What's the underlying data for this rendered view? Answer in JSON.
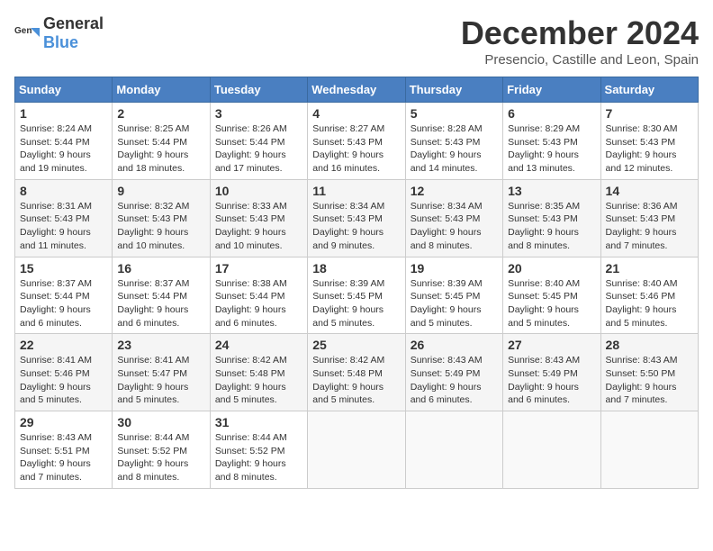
{
  "logo": {
    "general": "General",
    "blue": "Blue"
  },
  "title": {
    "month": "December 2024",
    "location": "Presencio, Castille and Leon, Spain"
  },
  "headers": [
    "Sunday",
    "Monday",
    "Tuesday",
    "Wednesday",
    "Thursday",
    "Friday",
    "Saturday"
  ],
  "weeks": [
    [
      {
        "day": "1",
        "sunrise": "8:24 AM",
        "sunset": "5:44 PM",
        "daylight": "9 hours and 19 minutes."
      },
      {
        "day": "2",
        "sunrise": "8:25 AM",
        "sunset": "5:44 PM",
        "daylight": "9 hours and 18 minutes."
      },
      {
        "day": "3",
        "sunrise": "8:26 AM",
        "sunset": "5:44 PM",
        "daylight": "9 hours and 17 minutes."
      },
      {
        "day": "4",
        "sunrise": "8:27 AM",
        "sunset": "5:43 PM",
        "daylight": "9 hours and 16 minutes."
      },
      {
        "day": "5",
        "sunrise": "8:28 AM",
        "sunset": "5:43 PM",
        "daylight": "9 hours and 14 minutes."
      },
      {
        "day": "6",
        "sunrise": "8:29 AM",
        "sunset": "5:43 PM",
        "daylight": "9 hours and 13 minutes."
      },
      {
        "day": "7",
        "sunrise": "8:30 AM",
        "sunset": "5:43 PM",
        "daylight": "9 hours and 12 minutes."
      }
    ],
    [
      {
        "day": "8",
        "sunrise": "8:31 AM",
        "sunset": "5:43 PM",
        "daylight": "9 hours and 11 minutes."
      },
      {
        "day": "9",
        "sunrise": "8:32 AM",
        "sunset": "5:43 PM",
        "daylight": "9 hours and 10 minutes."
      },
      {
        "day": "10",
        "sunrise": "8:33 AM",
        "sunset": "5:43 PM",
        "daylight": "9 hours and 10 minutes."
      },
      {
        "day": "11",
        "sunrise": "8:34 AM",
        "sunset": "5:43 PM",
        "daylight": "9 hours and 9 minutes."
      },
      {
        "day": "12",
        "sunrise": "8:34 AM",
        "sunset": "5:43 PM",
        "daylight": "9 hours and 8 minutes."
      },
      {
        "day": "13",
        "sunrise": "8:35 AM",
        "sunset": "5:43 PM",
        "daylight": "9 hours and 8 minutes."
      },
      {
        "day": "14",
        "sunrise": "8:36 AM",
        "sunset": "5:43 PM",
        "daylight": "9 hours and 7 minutes."
      }
    ],
    [
      {
        "day": "15",
        "sunrise": "8:37 AM",
        "sunset": "5:44 PM",
        "daylight": "9 hours and 6 minutes."
      },
      {
        "day": "16",
        "sunrise": "8:37 AM",
        "sunset": "5:44 PM",
        "daylight": "9 hours and 6 minutes."
      },
      {
        "day": "17",
        "sunrise": "8:38 AM",
        "sunset": "5:44 PM",
        "daylight": "9 hours and 6 minutes."
      },
      {
        "day": "18",
        "sunrise": "8:39 AM",
        "sunset": "5:45 PM",
        "daylight": "9 hours and 5 minutes."
      },
      {
        "day": "19",
        "sunrise": "8:39 AM",
        "sunset": "5:45 PM",
        "daylight": "9 hours and 5 minutes."
      },
      {
        "day": "20",
        "sunrise": "8:40 AM",
        "sunset": "5:45 PM",
        "daylight": "9 hours and 5 minutes."
      },
      {
        "day": "21",
        "sunrise": "8:40 AM",
        "sunset": "5:46 PM",
        "daylight": "9 hours and 5 minutes."
      }
    ],
    [
      {
        "day": "22",
        "sunrise": "8:41 AM",
        "sunset": "5:46 PM",
        "daylight": "9 hours and 5 minutes."
      },
      {
        "day": "23",
        "sunrise": "8:41 AM",
        "sunset": "5:47 PM",
        "daylight": "9 hours and 5 minutes."
      },
      {
        "day": "24",
        "sunrise": "8:42 AM",
        "sunset": "5:48 PM",
        "daylight": "9 hours and 5 minutes."
      },
      {
        "day": "25",
        "sunrise": "8:42 AM",
        "sunset": "5:48 PM",
        "daylight": "9 hours and 5 minutes."
      },
      {
        "day": "26",
        "sunrise": "8:43 AM",
        "sunset": "5:49 PM",
        "daylight": "9 hours and 6 minutes."
      },
      {
        "day": "27",
        "sunrise": "8:43 AM",
        "sunset": "5:49 PM",
        "daylight": "9 hours and 6 minutes."
      },
      {
        "day": "28",
        "sunrise": "8:43 AM",
        "sunset": "5:50 PM",
        "daylight": "9 hours and 7 minutes."
      }
    ],
    [
      {
        "day": "29",
        "sunrise": "8:43 AM",
        "sunset": "5:51 PM",
        "daylight": "9 hours and 7 minutes."
      },
      {
        "day": "30",
        "sunrise": "8:44 AM",
        "sunset": "5:52 PM",
        "daylight": "9 hours and 8 minutes."
      },
      {
        "day": "31",
        "sunrise": "8:44 AM",
        "sunset": "5:52 PM",
        "daylight": "9 hours and 8 minutes."
      },
      null,
      null,
      null,
      null
    ]
  ],
  "labels": {
    "sunrise": "Sunrise:",
    "sunset": "Sunset:",
    "daylight": "Daylight:"
  }
}
